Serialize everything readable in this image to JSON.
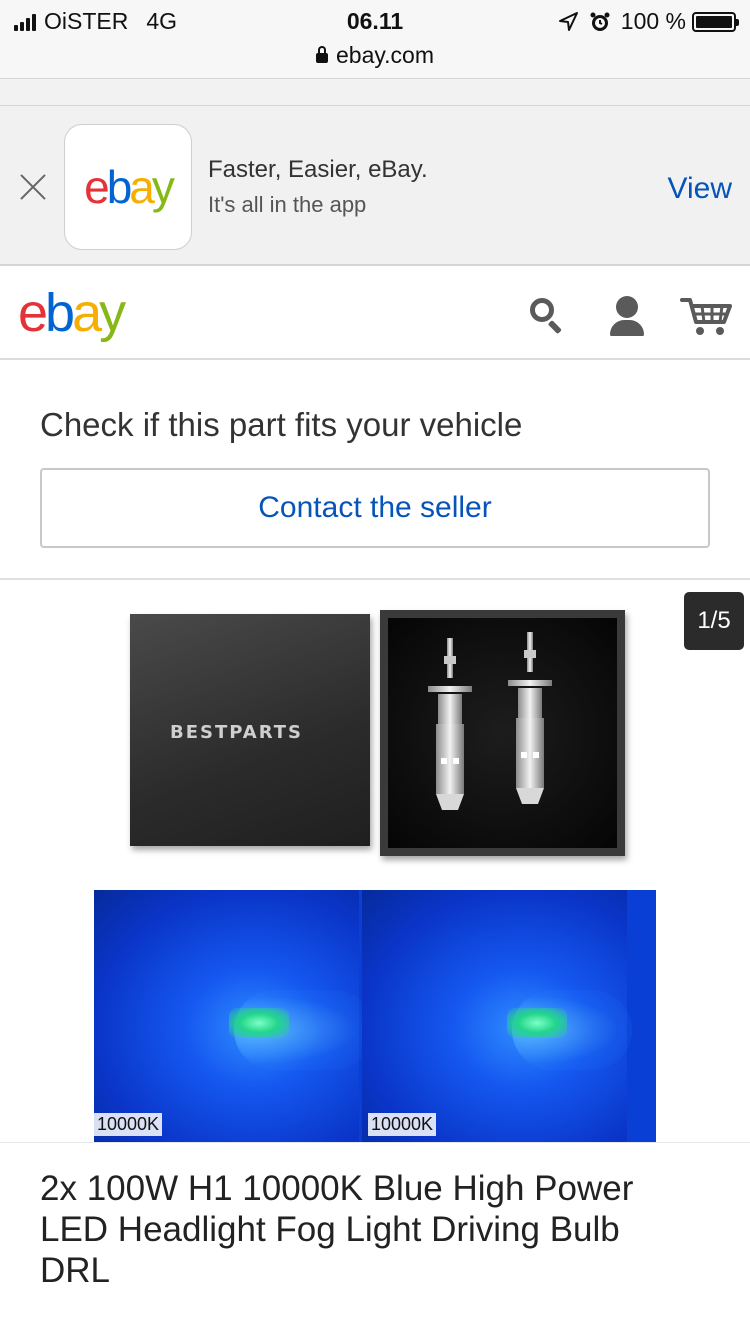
{
  "status_bar": {
    "carrier": "OiSTER",
    "network": "4G",
    "time": "06.11",
    "battery": "100 %",
    "url": "ebay.com"
  },
  "app_banner": {
    "logo_letters": [
      "e",
      "b",
      "a",
      "y"
    ],
    "title": "Faster, Easier, eBay.",
    "subtitle": "It's all in the app",
    "view_label": "View"
  },
  "header": {
    "logo_letters": [
      "e",
      "b",
      "a",
      "y"
    ],
    "icons": [
      "search-icon",
      "user-icon",
      "cart-icon"
    ]
  },
  "fitment": {
    "heading": "Check if this part fits your vehicle",
    "contact_label": "Contact the seller"
  },
  "gallery": {
    "counter": "1/5",
    "box_brand": "BESTPARTS",
    "color_temp_labels": [
      "10000K",
      "10000K"
    ]
  },
  "listing": {
    "title": "2x 100W H1 10000K  Blue High Power LED Headlight Fog Light Driving Bulb DRL"
  },
  "colors": {
    "link_blue": "#0654ba",
    "ebay_red": "#e53238",
    "ebay_blue": "#0064d2",
    "ebay_yellow": "#f5af02",
    "ebay_green": "#86b817"
  }
}
